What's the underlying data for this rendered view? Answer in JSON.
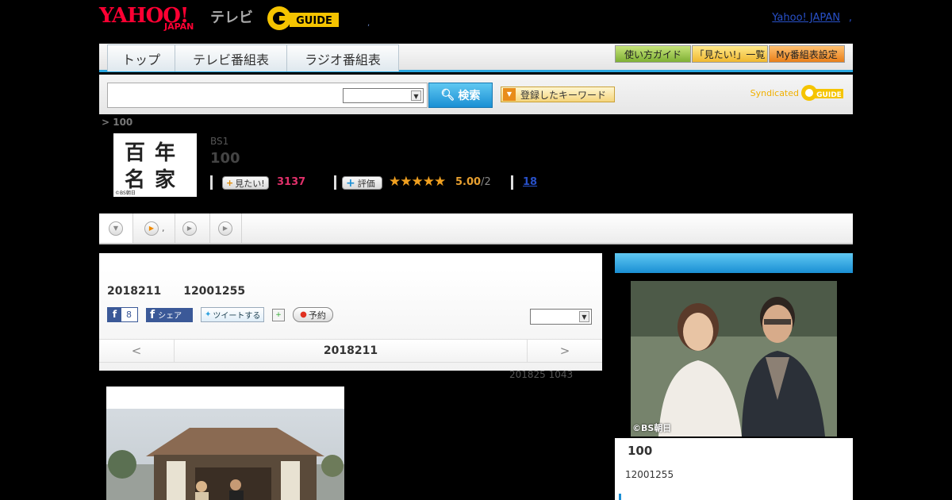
{
  "header": {
    "logo_yahoo": "YAHOO!",
    "logo_japan": "JAPAN",
    "logo_tv": "テレビ",
    "logo_guide": "G GUIDE",
    "dot": ",",
    "yahoo_japan_link": "Yahoo! JAPAN",
    "yahoo_japan_dot": ","
  },
  "nav": {
    "tabs": [
      "トップ",
      "テレビ番組表",
      "ラジオ番組表"
    ],
    "right_buttons": [
      "使い方ガイド",
      "「見たい!」一覧",
      "My番組表設定"
    ]
  },
  "search": {
    "placeholder": "",
    "button_label": "検索",
    "keywords_button": "登録したキーワード",
    "syndicated_text": "Syndicated"
  },
  "breadcrumb": "> 100",
  "program": {
    "thumb_caption": "©BS朝日",
    "channel": "BS1",
    "title": "100",
    "want_button": "見たい!",
    "want_count": "3137",
    "rate_button": "評価",
    "stars": "★★★★★",
    "score": "5.00",
    "score_of": "/2",
    "reviews": "18"
  },
  "subtabs": {
    "tab2_text": ","
  },
  "main": {
    "date": "2018211",
    "time": "12001255",
    "fb_count": "8",
    "share_label": "シェア",
    "tweet_label": "ツイートする",
    "reserve_label": "予約",
    "prev": "<",
    "next": ">",
    "nav_date": "2018211",
    "updated": "201825  1043"
  },
  "right": {
    "copyright": "©BS朝日",
    "title": "100",
    "time": "12001255"
  }
}
